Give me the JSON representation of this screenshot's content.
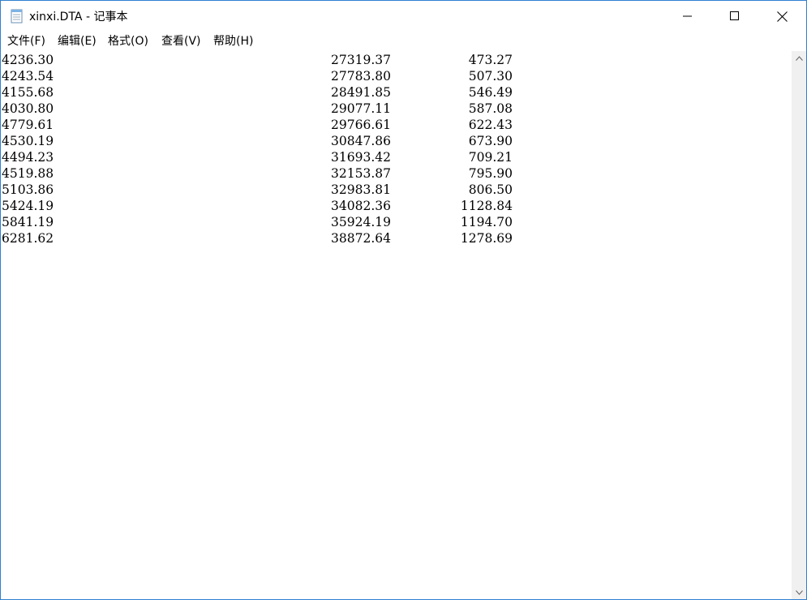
{
  "window": {
    "title": "xinxi.DTA - 记事本"
  },
  "menu": [
    {
      "label": "文件(F)"
    },
    {
      "label": "编辑(E)"
    },
    {
      "label": "格式(O)"
    },
    {
      "label": "查看(V)"
    },
    {
      "label": "帮助(H)"
    }
  ],
  "content": {
    "rows": [
      [
        "4236.30",
        "27319.37",
        "473.27"
      ],
      [
        "4243.54",
        "27783.80",
        "507.30"
      ],
      [
        "4155.68",
        "28491.85",
        "546.49"
      ],
      [
        "4030.80",
        "29077.11",
        "587.08"
      ],
      [
        "4779.61",
        "29766.61",
        "622.43"
      ],
      [
        "4530.19",
        "30847.86",
        "673.90"
      ],
      [
        "4494.23",
        "31693.42",
        "709.21"
      ],
      [
        "4519.88",
        "32153.87",
        "795.90"
      ],
      [
        "5103.86",
        "32983.81",
        "806.50"
      ],
      [
        "5424.19",
        "34082.36",
        "1128.84"
      ],
      [
        "5841.19",
        "35924.19",
        "1194.70"
      ],
      [
        "6281.62",
        "38872.64",
        "1278.69"
      ]
    ]
  },
  "icons": {
    "app": "notepad-icon",
    "minimize": "minimize-icon",
    "maximize": "maximize-icon",
    "close": "close-icon",
    "scroll_up": "chevron-up-icon",
    "scroll_down": "chevron-down-icon"
  }
}
